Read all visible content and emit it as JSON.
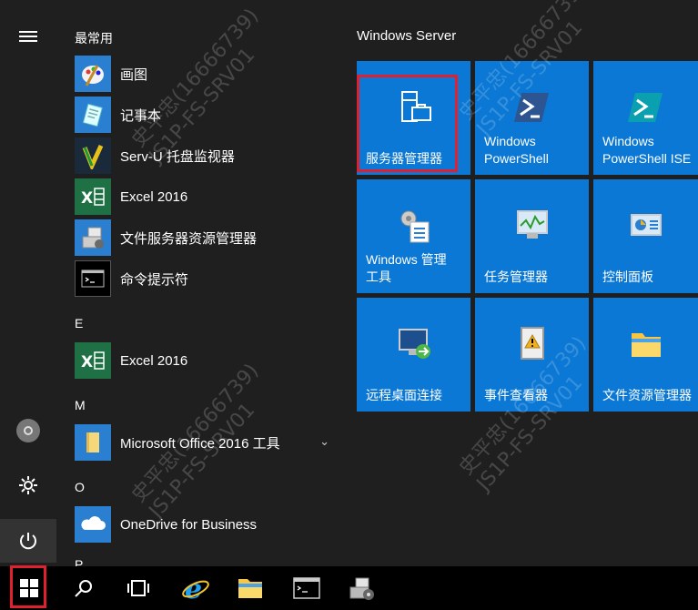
{
  "start_menu": {
    "rail": {
      "hamburger_icon": "hamburger-icon",
      "user_icon": "user-icon",
      "settings_icon": "gear-icon",
      "power_icon": "power-icon"
    },
    "groups": [
      {
        "header": "最常用"
      },
      {
        "header": "E"
      },
      {
        "header": "M"
      },
      {
        "header": "O"
      },
      {
        "header": "P"
      }
    ],
    "apps": [
      {
        "label": "画图",
        "icon": "paint-icon"
      },
      {
        "label": "记事本",
        "icon": "notepad-icon"
      },
      {
        "label": "Serv-U 托盘监视器",
        "icon": "servu-icon"
      },
      {
        "label": "Excel 2016",
        "icon": "excel-icon"
      },
      {
        "label": "文件服务器资源管理器",
        "icon": "file-server-icon"
      },
      {
        "label": "命令提示符",
        "icon": "cmd-icon"
      },
      {
        "label": "Excel 2016",
        "icon": "excel-icon"
      },
      {
        "label": "Microsoft Office 2016 工具",
        "icon": "folder-icon"
      },
      {
        "label": "OneDrive for Business",
        "icon": "onedrive-icon"
      }
    ],
    "tiles_header": "Windows Server",
    "tiles": [
      {
        "label": "服务器管理器",
        "icon": "server-manager-icon"
      },
      {
        "label": "Windows\nPowerShell",
        "icon": "powershell-icon"
      },
      {
        "label": "Windows\nPowerShell ISE",
        "icon": "powershell-ise-icon"
      },
      {
        "label": "Windows 管理\n工具",
        "icon": "admin-tools-icon"
      },
      {
        "label": "任务管理器",
        "icon": "task-manager-icon"
      },
      {
        "label": "控制面板",
        "icon": "control-panel-icon"
      },
      {
        "label": "远程桌面连接",
        "icon": "remote-desktop-icon"
      },
      {
        "label": "事件查看器",
        "icon": "event-viewer-icon"
      },
      {
        "label": "文件资源管理器",
        "icon": "file-explorer-icon"
      }
    ],
    "watermark": "史平忠(16666739)\nJS1P-FS-SRV01"
  },
  "taskbar": {
    "items": [
      {
        "icon": "windows-start-icon"
      },
      {
        "icon": "search-icon"
      },
      {
        "icon": "task-view-icon"
      },
      {
        "icon": "internet-explorer-icon"
      },
      {
        "icon": "file-explorer-icon"
      },
      {
        "icon": "cmd-icon"
      },
      {
        "icon": "server-icon"
      }
    ]
  },
  "colors": {
    "tile": "#0a78d4",
    "menu_bg": "#1f1f1f",
    "highlight": "#e0202e"
  }
}
